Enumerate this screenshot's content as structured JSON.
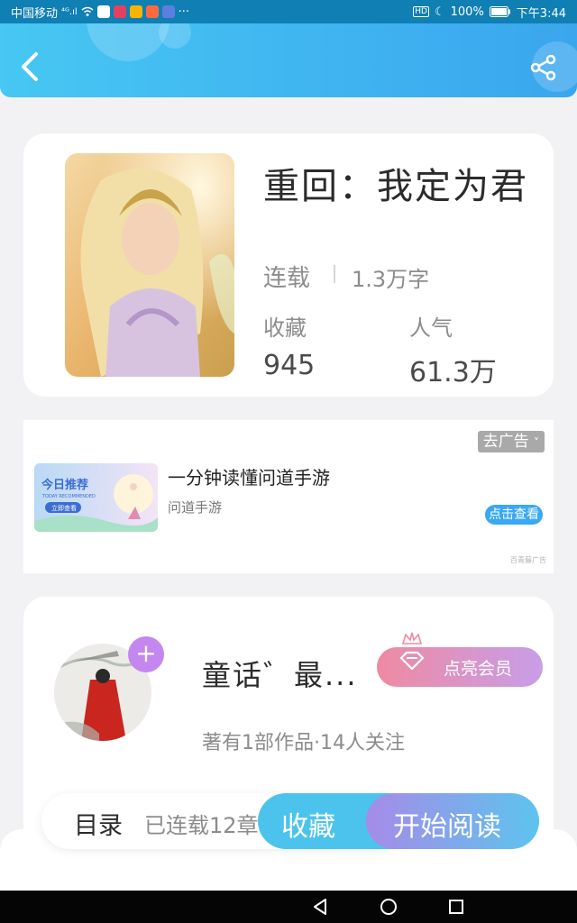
{
  "status_bar": {
    "carrier": "中国移动",
    "signal": "⁴ᴳ.ıl",
    "battery": "100%",
    "time": "下午3:44",
    "more": "···",
    "hd": "HD"
  },
  "header": {
    "back_icon": "chevron-left-icon",
    "share_icon": "share-icon"
  },
  "book": {
    "title": "重回：我定为君",
    "status": "连载",
    "word_count": "1.3万字",
    "favorites_label": "收藏",
    "favorites_value": "945",
    "popularity_label": "人气",
    "popularity_value": "61.3万"
  },
  "ad": {
    "close_label": "去广告",
    "title": "一分钟读懂问道手游",
    "subtitle": "问道手游",
    "cta": "点击查看",
    "source": "百青藤广告",
    "image_title": "今日推荐",
    "image_subtitle": "TODAY RECOMMENDED",
    "image_button": "立即查看"
  },
  "author": {
    "name": "童话゛最...",
    "follow_icon": "plus-icon",
    "vip_button": "点亮会员",
    "meta": "著有1部作品·14人关注"
  },
  "bottom": {
    "toc_label": "目录",
    "toc_count": "已连载12章",
    "collect": "收藏",
    "read": "开始阅读"
  },
  "colors": {
    "header_start": "#47c7f3",
    "header_end": "#3aa6ee",
    "collect": "#4cc3ec",
    "follow": "#c487f0"
  }
}
